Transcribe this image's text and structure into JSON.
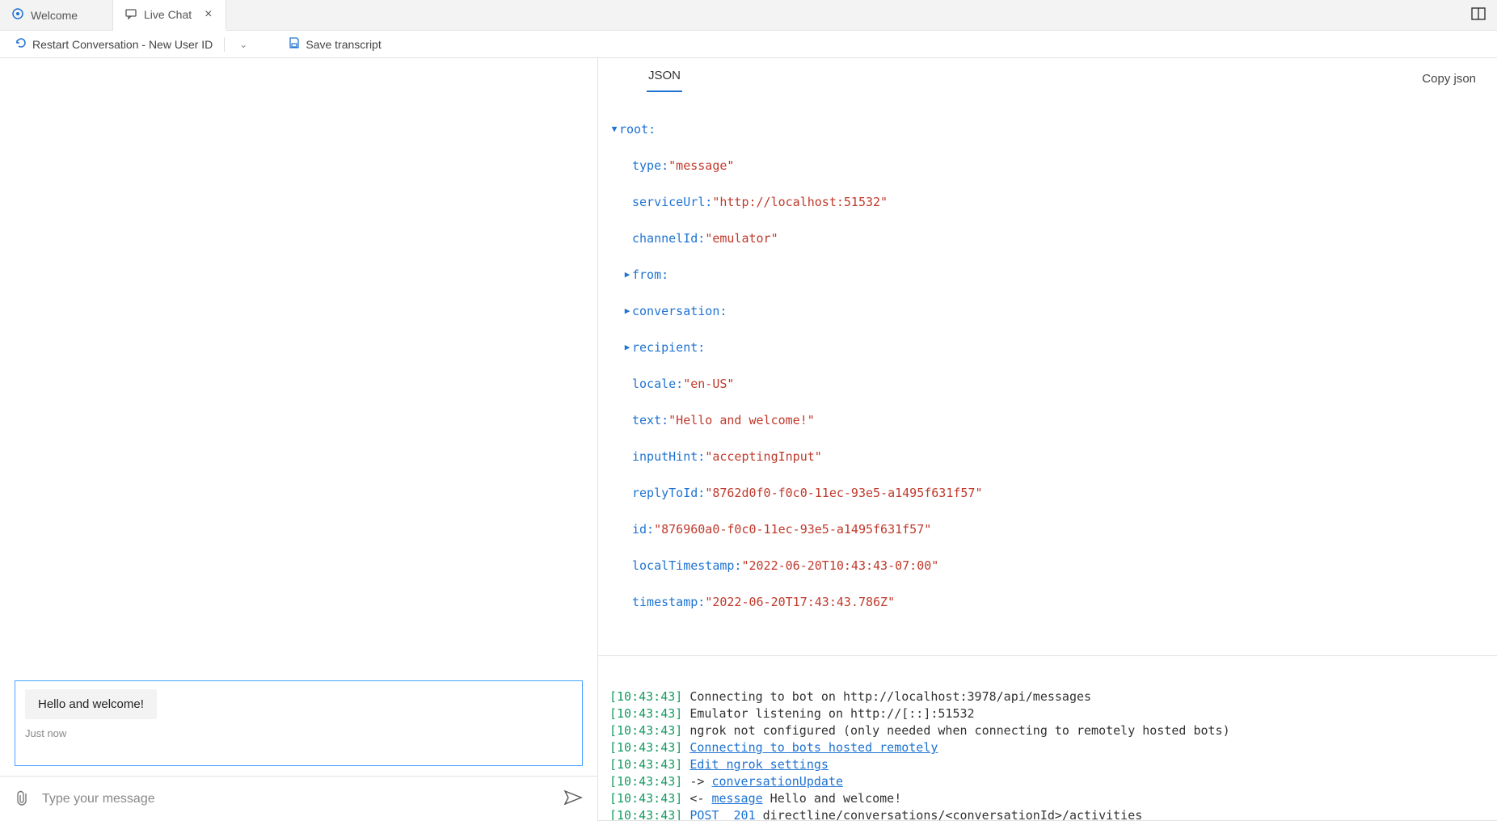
{
  "titlebar": {
    "tabs": [
      {
        "label": "Welcome",
        "icon": "welcome-icon",
        "active": false
      },
      {
        "label": "Live Chat",
        "icon": "chat-icon",
        "active": true
      }
    ]
  },
  "toolbar": {
    "restart_label": "Restart Conversation - New User ID",
    "save_label": "Save transcript"
  },
  "chat": {
    "message": "Hello and welcome!",
    "message_time": "Just now",
    "composer_placeholder": "Type your message"
  },
  "inspector": {
    "tab_label": "JSON",
    "copy_label": "Copy json",
    "tree": {
      "root_label": "root:",
      "type_key": "type:",
      "type_val": "\"message\"",
      "serviceUrl_key": "serviceUrl:",
      "serviceUrl_val": "\"http://localhost:51532\"",
      "channelId_key": "channelId:",
      "channelId_val": "\"emulator\"",
      "from_key": "from:",
      "conversation_key": "conversation:",
      "recipient_key": "recipient:",
      "locale_key": "locale:",
      "locale_val": "\"en-US\"",
      "text_key": "text:",
      "text_val": "\"Hello and welcome!\"",
      "inputHint_key": "inputHint:",
      "inputHint_val": "\"acceptingInput\"",
      "replyToId_key": "replyToId:",
      "replyToId_val": "\"8762d0f0-f0c0-11ec-93e5-a1495f631f57\"",
      "id_key": "id:",
      "id_val": "\"876960a0-f0c0-11ec-93e5-a1495f631f57\"",
      "localTimestamp_key": "localTimestamp:",
      "localTimestamp_val": "\"2022-06-20T10:43:43-07:00\"",
      "timestamp_key": "timestamp:",
      "timestamp_val": "\"2022-06-20T17:43:43.786Z\""
    }
  },
  "log": {
    "entries": [
      {
        "ts": "[10:43:43]",
        "text": " Connecting to bot on http://localhost:3978/api/messages"
      },
      {
        "ts": "[10:43:43]",
        "text": " Emulator listening on http://[::]:51532"
      },
      {
        "ts": "[10:43:43]",
        "text": " ngrok not configured (only needed when connecting to remotely hosted bots)"
      },
      {
        "ts": "[10:43:43]",
        "link1": "Connecting to bots hosted remotely"
      },
      {
        "ts": "[10:43:43]",
        "link1": "Edit ngrok settings"
      },
      {
        "ts": "[10:43:43]",
        "pre": " -> ",
        "link1": "conversationUpdate"
      },
      {
        "ts": "[10:43:43]",
        "pre": " <- ",
        "link1": "message",
        "post": " Hello and welcome!"
      },
      {
        "ts": "[10:43:43]",
        "pre": " ",
        "link1": "POST",
        "mid": "  ",
        "link2": "201",
        "post": " directline/conversations/<conversationId>/activities"
      }
    ]
  }
}
